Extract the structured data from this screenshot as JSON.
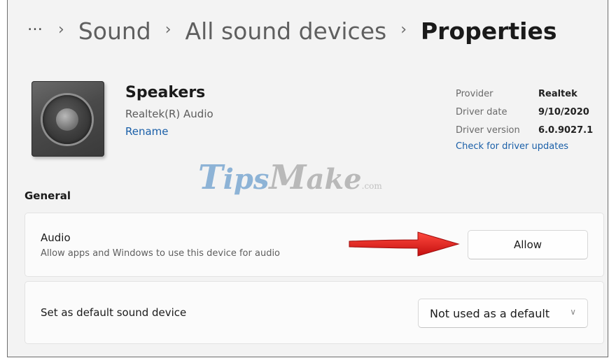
{
  "breadcrumb": {
    "more": "…",
    "items": [
      "Sound",
      "All sound devices"
    ],
    "current": "Properties",
    "separator": "›"
  },
  "device": {
    "name": "Speakers",
    "subtitle": "Realtek(R) Audio",
    "rename": "Rename"
  },
  "driver": {
    "rows": [
      {
        "label": "Provider",
        "value": "Realtek"
      },
      {
        "label": "Driver date",
        "value": "9/10/2020"
      },
      {
        "label": "Driver version",
        "value": "6.0.9027.1"
      }
    ],
    "update_link": "Check for driver updates"
  },
  "watermark": {
    "t": "T",
    "ips": "ips",
    "m": "M",
    "ake": "ake",
    "com": ".com"
  },
  "section_title": "General",
  "audio_card": {
    "title": "Audio",
    "subtitle": "Allow apps and Windows to use this device for audio",
    "button": "Allow"
  },
  "default_card": {
    "title": "Set as default sound device",
    "select_value": "Not used as a default"
  },
  "colors": {
    "accent_link": "#1a5fa8",
    "arrow": "#e01b1b",
    "background": "#f3f3f3"
  }
}
